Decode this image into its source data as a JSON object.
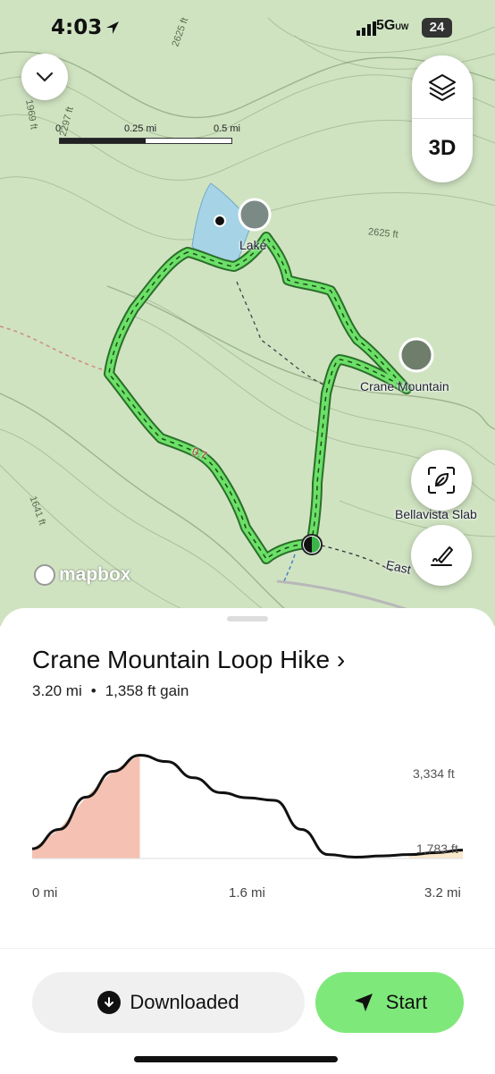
{
  "status": {
    "time": "4:03",
    "network": "5G",
    "network_sub": "UW",
    "battery": "24"
  },
  "map": {
    "scale": {
      "t0": "0",
      "t1": "0.25 mi",
      "t2": "0.5 mi"
    },
    "controls": {
      "three_d": "3D"
    },
    "labels": {
      "lake": "Lake",
      "crane": "Crane Mountain",
      "bellavista": "Bellavista Slab",
      "east": "East",
      "trail_num": "0.7"
    },
    "contours": {
      "c1": "2625 ft",
      "c2": "2297 ft",
      "c3": "1969 ft",
      "c4": "2625 ft",
      "c5": "1641 ft"
    },
    "attribution": "mapbox"
  },
  "route": {
    "title": "Crane Mountain Loop Hike ›",
    "distance": "3.20 mi",
    "separator": "•",
    "gain": "1,358 ft gain"
  },
  "chart_data": {
    "type": "area",
    "x": [
      0,
      0.2,
      0.4,
      0.6,
      0.8,
      1.0,
      1.2,
      1.4,
      1.6,
      1.8,
      2.0,
      2.2,
      2.4,
      2.6,
      2.8,
      3.0,
      3.2
    ],
    "y": [
      1850,
      2150,
      2650,
      3050,
      3300,
      3200,
      2950,
      2720,
      2640,
      2600,
      2150,
      1760,
      1720,
      1740,
      1760,
      1790,
      1830
    ],
    "y_marks": [
      "3,334 ft",
      "1,783 ft"
    ],
    "x_ticks": [
      "0 mi",
      "1.6 mi",
      "3.2 mi"
    ],
    "xlim": [
      0,
      3.2
    ],
    "ylim": [
      1700,
      3334
    ],
    "colors": {
      "line": "#111111",
      "climb": "#f4c1b2",
      "end": "#fae8cc"
    }
  },
  "footer": {
    "downloaded": "Downloaded",
    "start": "Start"
  },
  "icons": [
    "location-arrow-icon",
    "signal-icon",
    "chevron-down-icon",
    "layers-icon",
    "scan-icon",
    "draw-route-icon",
    "download-icon",
    "navigation-arrow-icon"
  ]
}
